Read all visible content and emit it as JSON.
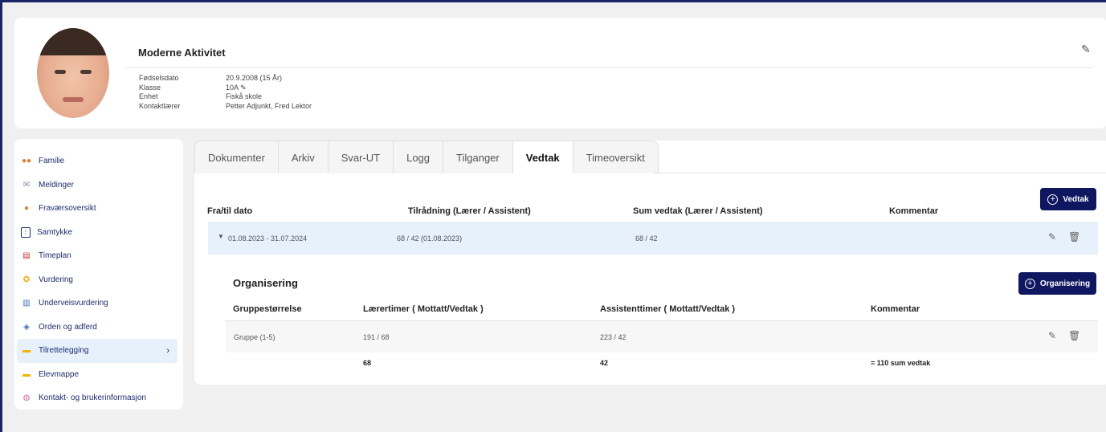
{
  "header": {
    "name": "Moderne Aktivitet",
    "fields": [
      {
        "label": "Fødselsdato",
        "value": "20.9.2008 (15 År)"
      },
      {
        "label": "Klasse",
        "value": "10A ✎"
      },
      {
        "label": "Enhet",
        "value": "Fiskå skole"
      },
      {
        "label": "Kontaktlærer",
        "value": "Petter Adjunkt, Fred Lektor"
      }
    ]
  },
  "sidebar": {
    "items": [
      {
        "label": "Familie",
        "icon": "family-icon"
      },
      {
        "label": "Meldinger",
        "icon": "mail-icon"
      },
      {
        "label": "Fraværsoversikt",
        "icon": "absence-icon"
      },
      {
        "label": "Samtykke",
        "icon": "consent-icon"
      },
      {
        "label": "Timeplan",
        "icon": "timetable-icon"
      },
      {
        "label": "Vurdering",
        "icon": "medal-icon"
      },
      {
        "label": "Underveisvurdering",
        "icon": "notebook-icon"
      },
      {
        "label": "Orden og adferd",
        "icon": "behavior-icon"
      },
      {
        "label": "Tilrettelegging",
        "icon": "folder-icon",
        "active": true
      },
      {
        "label": "Elevmappe",
        "icon": "student-folder-icon"
      },
      {
        "label": "Kontakt- og brukerinformasjon",
        "icon": "contact-icon"
      }
    ]
  },
  "tabs": [
    "Dokumenter",
    "Arkiv",
    "Svar-UT",
    "Logg",
    "Tilganger",
    "Vedtak",
    "Timeoversikt"
  ],
  "active_tab": "Vedtak",
  "vedtak": {
    "add_button": "Vedtak",
    "columns": [
      "Fra/til dato",
      "Tilrådning (Lærer / Assistent)",
      "Sum vedtak (Lærer / Assistent)",
      "Kommentar"
    ],
    "row": {
      "period": "01.08.2023 - 31.07.2024",
      "recommendation": "68 / 42 (01.08.2023)",
      "sum": "68 / 42",
      "comment": ""
    }
  },
  "organisering": {
    "title": "Organisering",
    "add_button": "Organisering",
    "columns": [
      "Gruppestørrelse",
      "Lærertimer ( Mottatt/Vedtak )",
      "Assistenttimer ( Mottatt/Vedtak )",
      "Kommentar"
    ],
    "row": {
      "group": "Gruppe (1-5)",
      "teacher_hours": "191 / 68",
      "assistant_hours": "223 / 42",
      "comment": ""
    },
    "totals": {
      "teacher": "68",
      "assistant": "42",
      "sum": "= 110 sum vedtak"
    }
  }
}
